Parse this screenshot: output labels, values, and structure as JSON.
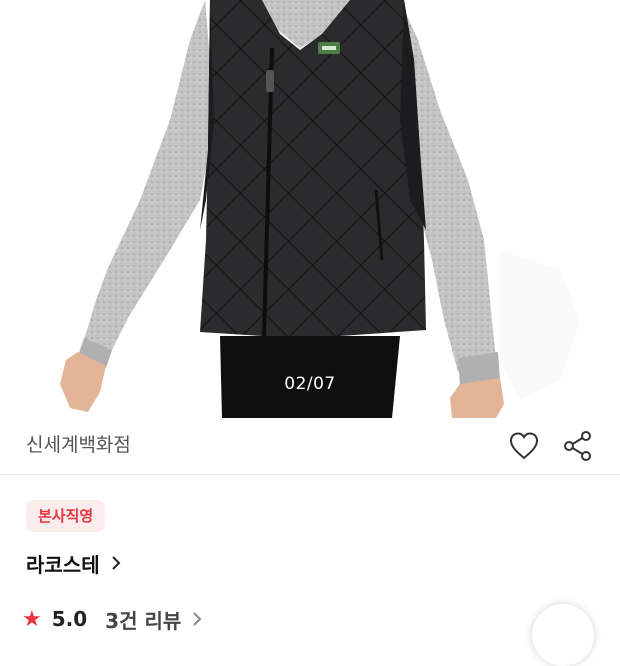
{
  "gallery": {
    "counter": "02/07",
    "image_alt": "product-photo-lacoste-quilted-vest"
  },
  "seller": {
    "name": "신세계백화점"
  },
  "actions": {
    "like_icon": "heart-icon",
    "share_icon": "share-icon"
  },
  "badge": {
    "label": "본사직영",
    "text_color": "#e8343c",
    "bg_color": "#fdeced"
  },
  "brand": {
    "name": "라코스테"
  },
  "rating": {
    "value": "5.0",
    "reviews": "3건 리뷰",
    "star_color": "#e8343c"
  }
}
